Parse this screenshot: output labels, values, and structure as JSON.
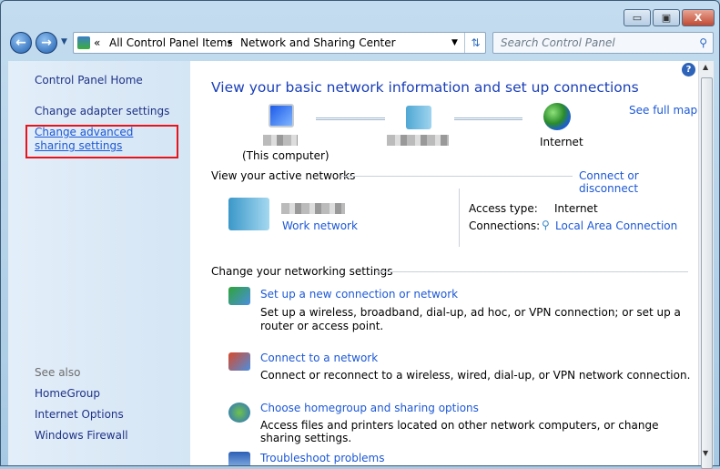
{
  "window": {
    "minimize": "▭",
    "maximize": "▣",
    "close": "X"
  },
  "address": {
    "crumbs": [
      "All Control Panel Items",
      "Network and Sharing Center"
    ],
    "overflow": "«",
    "separator": "▸"
  },
  "search": {
    "placeholder": "Search Control Panel"
  },
  "sidebar": {
    "home": "Control Panel Home",
    "links": [
      "Change adapter settings",
      "Change advanced sharing settings"
    ],
    "see_also": "See also",
    "see_also_items": [
      "HomeGroup",
      "Internet Options",
      "Windows Firewall"
    ]
  },
  "main": {
    "title": "View your basic network information and set up connections",
    "see_full_map": "See full map",
    "map": {
      "computer_label": "(This computer)",
      "internet_label": "Internet"
    },
    "active_networks": "View your active networks",
    "connect_or_disconnect": "Connect or disconnect",
    "network_type": "Work network",
    "access_type_label": "Access type:",
    "access_type_value": "Internet",
    "connections_label": "Connections:",
    "connections_value": "Local Area Connection",
    "change_settings": "Change your networking settings",
    "tasks": [
      {
        "title": "Set up a new connection or network",
        "desc": "Set up a wireless, broadband, dial-up, ad hoc, or VPN connection; or set up a router or access point."
      },
      {
        "title": "Connect to a network",
        "desc": "Connect or reconnect to a wireless, wired, dial-up, or VPN network connection."
      },
      {
        "title": "Choose homegroup and sharing options",
        "desc": "Access files and printers located on other network computers, or change sharing settings."
      },
      {
        "title": "Troubleshoot problems",
        "desc": ""
      }
    ]
  },
  "highlight_color": "#e8141b"
}
